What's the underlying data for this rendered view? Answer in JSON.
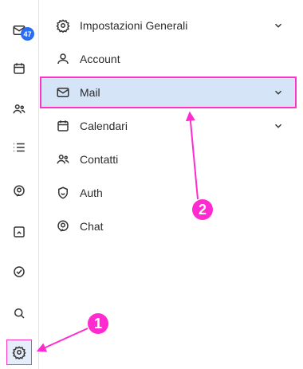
{
  "rail": {
    "badge_count": "47",
    "items": [
      {
        "name": "mail-icon"
      },
      {
        "name": "calendar-icon"
      },
      {
        "name": "contacts-icon"
      },
      {
        "name": "tasks-list-icon"
      },
      {
        "name": "chat-icon"
      },
      {
        "name": "files-icon"
      },
      {
        "name": "check-circle-icon"
      },
      {
        "name": "search-icon"
      },
      {
        "name": "settings-gear-icon"
      }
    ]
  },
  "settings_menu": {
    "items": [
      {
        "label": "Impostazioni Generali",
        "icon": "gear-icon",
        "has_chevron": true
      },
      {
        "label": "Account",
        "icon": "user-icon",
        "has_chevron": false
      },
      {
        "label": "Mail",
        "icon": "mail-icon",
        "has_chevron": true,
        "selected": true
      },
      {
        "label": "Calendari",
        "icon": "calendar-icon",
        "has_chevron": true
      },
      {
        "label": "Contatti",
        "icon": "contacts-icon",
        "has_chevron": false
      },
      {
        "label": "Auth",
        "icon": "shield-icon",
        "has_chevron": false
      },
      {
        "label": "Chat",
        "icon": "chat-icon",
        "has_chevron": false
      }
    ]
  },
  "callouts": {
    "one": "1",
    "two": "2"
  },
  "colors": {
    "accent_magenta": "#ff2bd0",
    "selected_bg": "#d6e4f7",
    "badge_blue": "#2a6df4"
  }
}
